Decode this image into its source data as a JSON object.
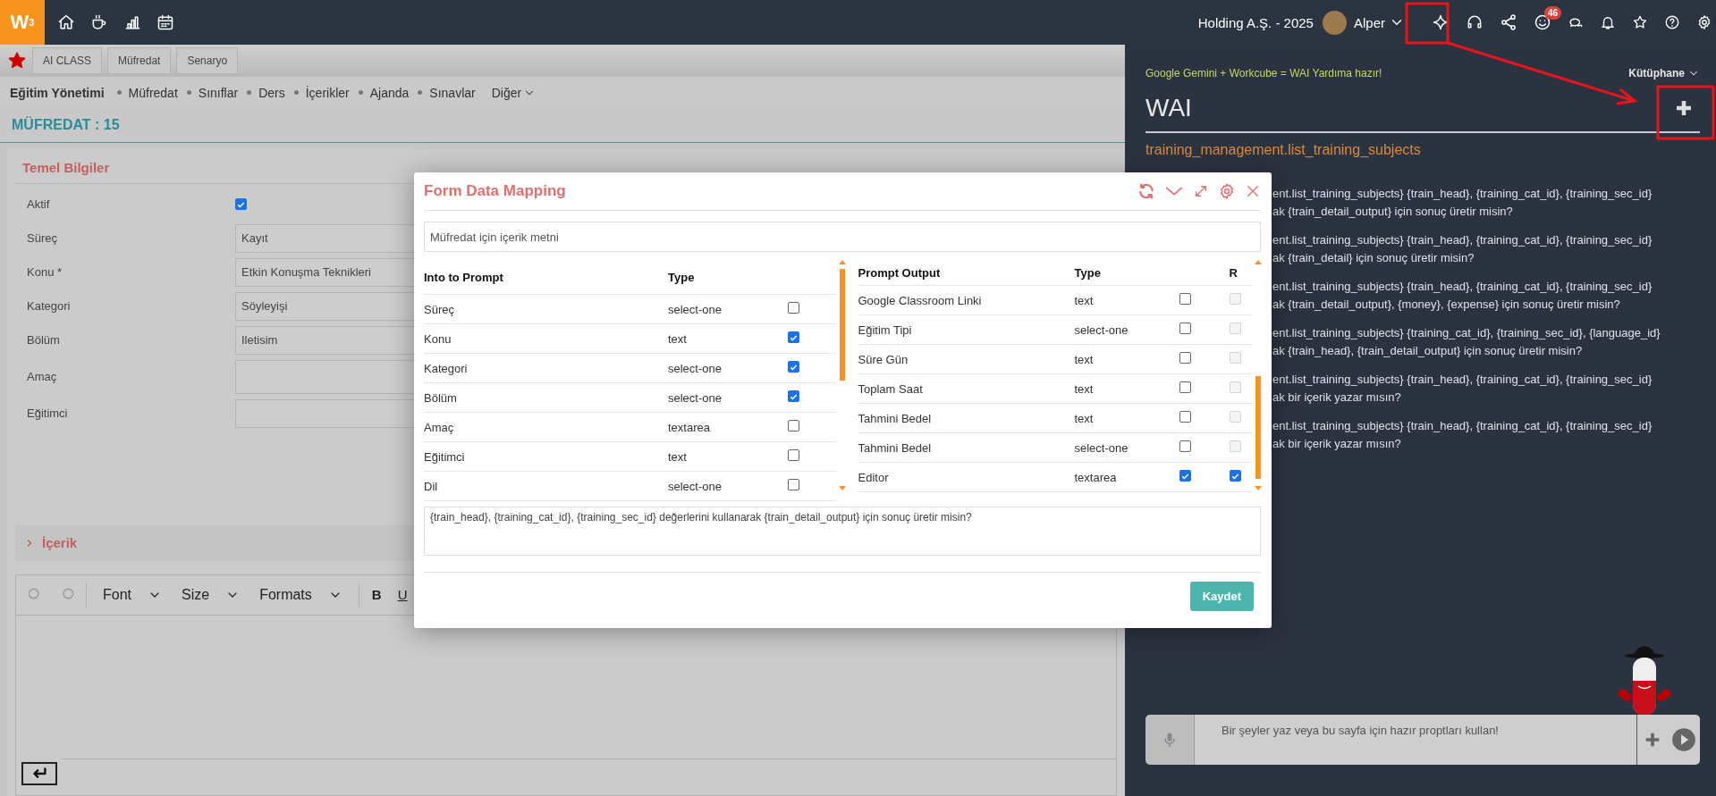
{
  "top_bar": {
    "logo": "W$^{3}$",
    "company": "Holding A.Ş. - 2025",
    "user": "Alper",
    "notification_count": "46"
  },
  "quick_tabs": [
    "AI CLASS",
    "Müfredat",
    "Senaryo"
  ],
  "nav": {
    "title": "Eğitim Yönetimi",
    "items": [
      "Müfredat",
      "Sınıflar",
      "Ders",
      "İçerikler",
      "Ajanda",
      "Sınavlar"
    ],
    "more": "Diğer"
  },
  "page_title": "MÜFREDAT : 15",
  "form": {
    "title": "Temel Bilgiler",
    "active": {
      "label": "Aktif",
      "checked": true
    },
    "fields": [
      {
        "label": "Süreç",
        "kind": "input",
        "value": "Kayıt"
      },
      {
        "label": "Konu *",
        "kind": "input",
        "value": "Etkin Konuşma Teknikleri"
      },
      {
        "label": "Kategori",
        "kind": "input",
        "value": "Söyleyişi"
      },
      {
        "label": "Bölüm",
        "kind": "input",
        "value": "Iletisim"
      },
      {
        "label": "Amaç",
        "kind": "textarea"
      },
      {
        "label": "Eğitimci",
        "kind": "input"
      }
    ]
  },
  "content_section": {
    "title": "İçerik",
    "expanded": false
  },
  "editor_toolbar": {
    "font": "Font",
    "size": "Size",
    "formats": "Formats",
    "bold": "B",
    "underline": "U"
  },
  "assistant": {
    "tagline": "Google Gemini + Workcube = WAI Yardıma hazır!",
    "library": "Kütüphane",
    "title": "WAI",
    "context": "training_management.list_training_subjects",
    "prompts": [
      {
        "line_1": "ent.list_training_subjects} {train_head}, {training_cat_id}, {training_sec_id}",
        "line_2": "ak {train_detail_output} için sonuç üretir misin?"
      },
      {
        "line_1": "ent.list_training_subjects} {train_head}, {training_cat_id}, {training_sec_id}",
        "line_2": "ak {train_detail} için sonuç üretir misin?"
      },
      {
        "line_1": "ent.list_training_subjects} {train_head}, {training_cat_id}, {training_sec_id}",
        "line_2": "ak {train_detail_output}, {money}, {expense} için sonuç üretir misin?"
      },
      {
        "line_1": "ent.list_training_subjects} {training_cat_id}, {training_sec_id}, {language_id}",
        "line_2": "ak {train_head}, {train_detail_output} için sonuç üretir misin?"
      },
      {
        "line_1": "ent.list_training_subjects} {train_head}, {training_cat_id}, {training_sec_id}",
        "line_2": "ak bir içerik yazar mısın?"
      },
      {
        "line_1": "ent.list_training_subjects} {train_head}, {training_cat_id}, {training_sec_id}",
        "line_2": "ak bir içerik yazar mısın?"
      }
    ],
    "chat_placeholder": "Bir şeyler yaz veya bu sayfa için hazır proptları kullan!"
  },
  "modal": {
    "title": "Form Data Mapping",
    "description": "Müfredat için içerik metni",
    "input_table": {
      "columns": [
        "Into to Prompt",
        "Type"
      ],
      "rows": [
        {
          "field": "Süreç",
          "type": "select-one",
          "checked": false
        },
        {
          "field": "Konu",
          "type": "text",
          "checked": true
        },
        {
          "field": "Kategori",
          "type": "select-one",
          "checked": true
        },
        {
          "field": "Bölüm",
          "type": "select-one",
          "checked": true
        },
        {
          "field": "Amaç",
          "type": "textarea",
          "checked": false
        },
        {
          "field": "Eğitimci",
          "type": "text",
          "checked": false
        },
        {
          "field": "Dil",
          "type": "select-one",
          "checked": false
        }
      ]
    },
    "output_table": {
      "columns": [
        "Prompt Output",
        "Type",
        "R"
      ],
      "rows": [
        {
          "field": "Google Classroom Linki",
          "type": "text",
          "checked": false,
          "r_checked": false,
          "r_disabled": true
        },
        {
          "field": "Eğitim Tipi",
          "type": "select-one",
          "checked": false,
          "r_checked": false,
          "r_disabled": true
        },
        {
          "field": "Süre Gün",
          "type": "text",
          "checked": false,
          "r_checked": false,
          "r_disabled": true
        },
        {
          "field": "Toplam Saat",
          "type": "text",
          "checked": false,
          "r_checked": false,
          "r_disabled": true
        },
        {
          "field": "Tahmini Bedel",
          "type": "text",
          "checked": false,
          "r_checked": false,
          "r_disabled": true
        },
        {
          "field": "Tahmini Bedel",
          "type": "select-one",
          "checked": false,
          "r_checked": false,
          "r_disabled": true
        },
        {
          "field": "Editor",
          "type": "textarea",
          "checked": true,
          "r_checked": true,
          "r_disabled": false
        }
      ]
    },
    "prompt": "{train_head}, {training_cat_id}, {training_sec_id} değerlerini kullanarak {train_detail_output} için sonuç üretir misin?",
    "save_button": "Kaydet"
  }
}
